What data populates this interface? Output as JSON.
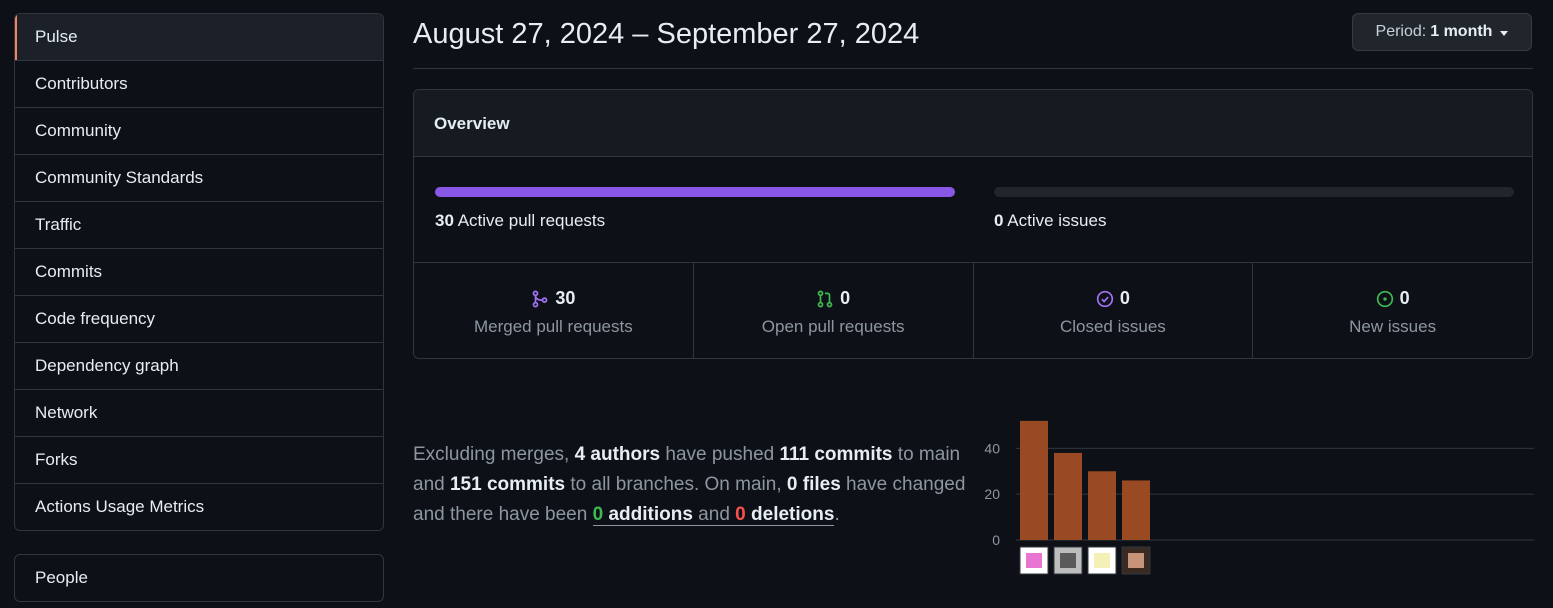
{
  "sidebar": {
    "items": [
      {
        "label": "Pulse",
        "selected": true
      },
      {
        "label": "Contributors"
      },
      {
        "label": "Community"
      },
      {
        "label": "Community Standards"
      },
      {
        "label": "Traffic"
      },
      {
        "label": "Commits"
      },
      {
        "label": "Code frequency"
      },
      {
        "label": "Dependency graph"
      },
      {
        "label": "Network"
      },
      {
        "label": "Forks"
      },
      {
        "label": "Actions Usage Metrics"
      }
    ],
    "secondary": [
      {
        "label": "People"
      }
    ]
  },
  "header": {
    "date_range": "August 27, 2024 – September 27, 2024",
    "period_prefix": "Period:",
    "period_value": "1 month"
  },
  "overview": {
    "title": "Overview",
    "active_pull_requests": {
      "count": "30",
      "label": "Active pull requests",
      "fill_fraction": 1.0
    },
    "active_issues": {
      "count": "0",
      "label": "Active issues",
      "fill_fraction": 0.0
    },
    "stats": [
      {
        "icon": "merged-pr-icon",
        "value": "30",
        "label": "Merged pull requests",
        "color": "#a371f7"
      },
      {
        "icon": "open-pr-icon",
        "value": "0",
        "label": "Open pull requests",
        "color": "#3fb950"
      },
      {
        "icon": "closed-issue-icon",
        "value": "0",
        "label": "Closed issues",
        "color": "#a371f7"
      },
      {
        "icon": "new-issue-icon",
        "value": "0",
        "label": "New issues",
        "color": "#3fb950"
      }
    ]
  },
  "summary": {
    "t1": "Excluding merges, ",
    "authors": "4 authors",
    "t2": " have pushed ",
    "commits_main": "111 commits",
    "t3": " to main and ",
    "commits_all": "151 commits",
    "t4": " to all branches. On main, ",
    "files": "0 files",
    "t5": " have changed and there have been ",
    "additions_num": "0",
    "additions_word": " additions",
    "t6": " and ",
    "deletions_num": "0",
    "deletions_word": " deletions",
    "t7": "."
  },
  "chart_data": {
    "type": "bar",
    "categories": [
      "author-1",
      "author-2",
      "author-3",
      "author-4"
    ],
    "values": [
      52,
      38,
      30,
      26
    ],
    "ylim": [
      0,
      55
    ],
    "yticks": [
      0,
      20,
      40
    ],
    "bar_color": "#9a4a22",
    "grid": true
  }
}
